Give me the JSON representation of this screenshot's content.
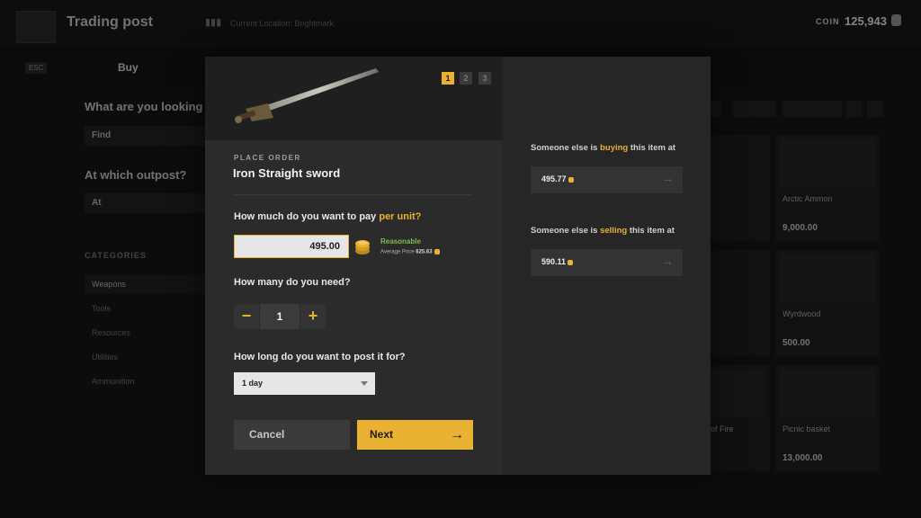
{
  "header": {
    "title": "Trading post",
    "location": "Current Location: Brightmark",
    "coin_label": "COIN",
    "coin_value": "125,943"
  },
  "tabs": {
    "esc": "ESC",
    "buy": "Buy"
  },
  "search": {
    "question": "What are you looking",
    "find_label": "Find",
    "outpost_question": "At which outpost?",
    "at_label": "At"
  },
  "categories": {
    "heading": "CATEGORIES",
    "items": [
      "Weapons",
      "Tools",
      "Resources",
      "Utilities",
      "Ammunition"
    ],
    "active": "Weapons"
  },
  "grid_cards": [
    {
      "name": "Arctic Ammon",
      "price": "9,000.00"
    },
    {
      "name": "Wyrdwood",
      "price": "500.00"
    },
    {
      "name": "Picnic basket",
      "price": "13,000.00"
    },
    {
      "name": "of Fire",
      "price": ""
    }
  ],
  "modal": {
    "steps": [
      "1",
      "2",
      "3"
    ],
    "active_step": "1",
    "caption": "PLACE ORDER",
    "item_name": "Iron Straight sword",
    "price_question": "How much do you want to pay ",
    "price_question_highlight": "per unit?",
    "price_value": "495.00",
    "assessment": "Reasonable",
    "average_label": "Average Price",
    "average_value": "625.63",
    "quantity_question": "How many do you need?",
    "quantity": "1",
    "duration_question": "How long do you want to post it for?",
    "duration_value": "1 day",
    "cancel_label": "Cancel",
    "next_label": "Next",
    "buying_prefix": "Someone else is ",
    "buying_word": "buying",
    "buying_suffix": " this item at",
    "buying_price": "495.77",
    "selling_prefix": "Someone else is ",
    "selling_word": "selling",
    "selling_suffix": " this item at",
    "selling_price": "590.11"
  },
  "colors": {
    "accent": "#e9b233",
    "positive": "#7fbf4f"
  }
}
